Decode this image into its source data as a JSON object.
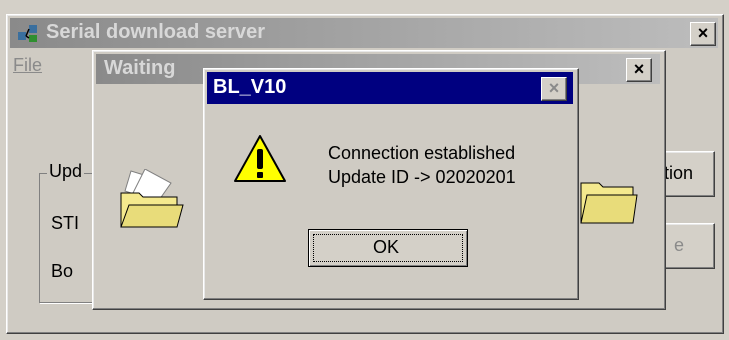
{
  "main_window": {
    "title": "Serial download server",
    "close_glyph": "×",
    "menu": {
      "file": "File"
    },
    "group_label": "Upd",
    "row1_label": "STI",
    "row2_label": "Bo",
    "right_button_top": "tion",
    "right_button_bottom": "e"
  },
  "waiting_window": {
    "title": "Waiting",
    "close_glyph": "×"
  },
  "dialog": {
    "title": "BL_V10",
    "close_glyph": "×",
    "message_line1": "Connection established",
    "message_line2": "Update ID -> 02020201",
    "ok_label": "OK",
    "icon": "warning-icon"
  },
  "colors": {
    "active_title": "#000080",
    "inactive_title": "#8a8a8a",
    "warning_yellow": "#ffff00",
    "folder_yellow": "#f4e98e"
  }
}
